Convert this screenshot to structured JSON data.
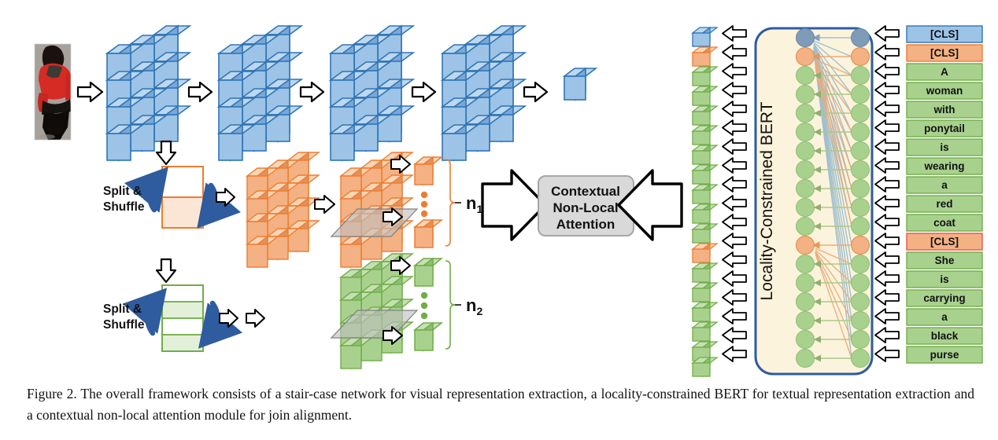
{
  "figure": {
    "caption_number": "Figure 2.",
    "caption_text": "The overall framework consists of a stair-case network for visual representation extraction, a locality-constrained BERT for textual representation extraction and a contextual non-local attention module for join alignment."
  },
  "colors": {
    "blue_fill": "#9DC3E6",
    "blue_top": "#BDD7EE",
    "blue_side": "#7BA7D7",
    "blue_border": "#2E75B6",
    "orange_fill": "#F4B183",
    "orange_top": "#FBD5B5",
    "orange_side": "#E2915B",
    "orange_border": "#ED7D31",
    "green_fill": "#A9D18E",
    "green_top": "#C5E0B4",
    "green_side": "#8CBF73",
    "green_border": "#70AD47",
    "grey_box_fill": "#D9D9D9",
    "grey_box_border": "#A6A6A6",
    "bert_fill": "#FCF3DC",
    "bert_border": "#2E5C9E",
    "node_blue": "#7E9BB8",
    "node_orange": "#F4B183",
    "node_green": "#A9D18E",
    "shuffle_arrow": "#2E5C9E",
    "plane_fill": "#BFBFBF",
    "arrow_outline": "#000000"
  },
  "visual_branch": {
    "input_image_alt": "person-photo-woman-red-coat",
    "cnn_stages": [
      "stage-1",
      "stage-2",
      "stage-3",
      "stage-4"
    ],
    "output_feature": "blue-feature-cube"
  },
  "split_shuffle": {
    "orange_label_line1": "Split &",
    "orange_label_line2": "Shuffle",
    "green_label_line1": "Split &",
    "green_label_line2": "Shuffle"
  },
  "part_counts": {
    "orange_label": "n",
    "orange_sub": "1",
    "green_label": "n",
    "green_sub": "2"
  },
  "attention_module": {
    "line1": "Contextual",
    "line2": "Non-Local",
    "line3": "Attention"
  },
  "bert": {
    "title": "Locality-Constrained BERT",
    "node_rows": 18,
    "node_types": [
      "blue",
      "orange",
      "green",
      "green",
      "green",
      "green",
      "green",
      "green",
      "green",
      "green",
      "green",
      "orange",
      "green",
      "green",
      "green",
      "green",
      "green",
      "green"
    ]
  },
  "tokens": [
    {
      "text": "[CLS]",
      "type": "blue"
    },
    {
      "text": "[CLS]",
      "type": "orange"
    },
    {
      "text": "A",
      "type": "green"
    },
    {
      "text": "woman",
      "type": "green"
    },
    {
      "text": "with",
      "type": "green"
    },
    {
      "text": "ponytail",
      "type": "green"
    },
    {
      "text": "is",
      "type": "green"
    },
    {
      "text": "wearing",
      "type": "green"
    },
    {
      "text": "a",
      "type": "green"
    },
    {
      "text": "red",
      "type": "green"
    },
    {
      "text": "coat",
      "type": "green"
    },
    {
      "text": "[CLS]",
      "type": "orange"
    },
    {
      "text": "She",
      "type": "green"
    },
    {
      "text": "is",
      "type": "green"
    },
    {
      "text": "carrying",
      "type": "green"
    },
    {
      "text": "a",
      "type": "green"
    },
    {
      "text": "black",
      "type": "green"
    },
    {
      "text": "purse",
      "type": "green"
    }
  ]
}
